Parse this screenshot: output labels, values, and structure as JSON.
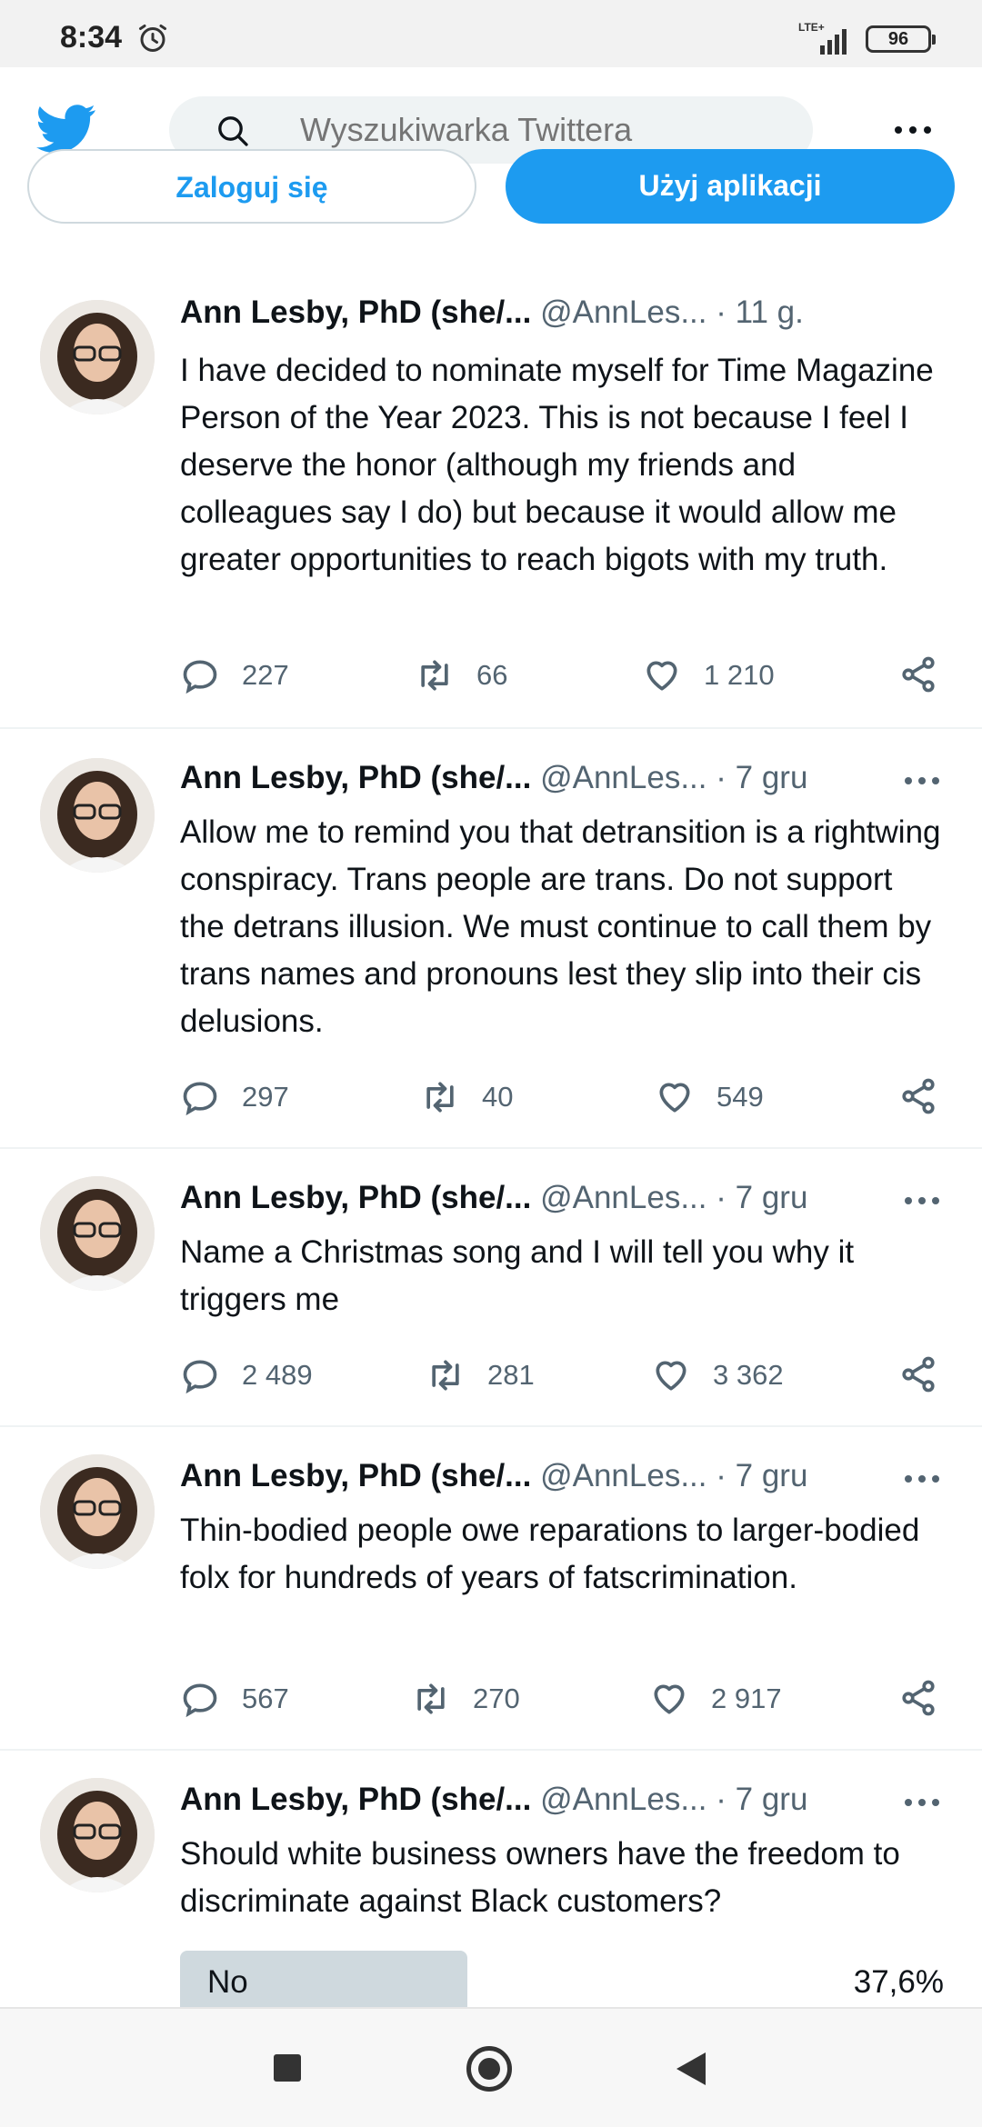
{
  "status_bar": {
    "time": "8:34",
    "network": "LTE+",
    "battery": "96"
  },
  "header": {
    "search_placeholder": "Wyszukiwarka Twittera",
    "login_label": "Zaloguj się",
    "app_label": "Użyj aplikacji"
  },
  "icons": {
    "logo": "twitter-bird-icon",
    "search": "search-icon",
    "more": "more-horizontal-icon",
    "reply": "reply-icon",
    "retweet": "retweet-icon",
    "like": "heart-icon",
    "share": "share-icon"
  },
  "colors": {
    "brand": "#1d9bf0",
    "text": "#0f1419",
    "muted": "#536471"
  },
  "tweets": [
    {
      "name": "Ann Lesby, PhD (she/...",
      "handle": "@AnnLes...",
      "date": "· 11 g.",
      "text": "I have decided to nominate myself for Time Magazine Person of the Year 2023. This is not because I feel I deserve the honor (although my friends and colleagues say I do) but because it would allow me greater opportunities to reach bigots with my truth.",
      "replies": "227",
      "retweets": "66",
      "likes": "1 210"
    },
    {
      "name": "Ann Lesby, PhD (she/...",
      "handle": "@AnnLes...",
      "date": "· 7 gru",
      "text": "Allow me to remind you that detransition is a rightwing conspiracy. Trans people are trans. Do not support the detrans illusion. We must continue to call them by trans names and pronouns lest they slip into their cis delusions.",
      "replies": "297",
      "retweets": "40",
      "likes": "549"
    },
    {
      "name": "Ann Lesby, PhD (she/...",
      "handle": "@AnnLes...",
      "date": "· 7 gru",
      "text": "Name a Christmas song and I will tell you why it triggers me",
      "replies": "2 489",
      "retweets": "281",
      "likes": "3 362"
    },
    {
      "name": "Ann Lesby, PhD (she/...",
      "handle": "@AnnLes...",
      "date": "· 7 gru",
      "text": "Thin-bodied people owe reparations to larger-bodied folx for hundreds of years of fatscrimination.",
      "replies": "567",
      "retweets": "270",
      "likes": "2 917"
    },
    {
      "name": "Ann Lesby, PhD (she/...",
      "handle": "@AnnLes...",
      "date": "· 7 gru",
      "text": "Should white business owners have the freedom to discriminate against Black customers?",
      "poll": {
        "option": "No",
        "percent": "37,6%",
        "fraction": 0.376
      }
    }
  ]
}
